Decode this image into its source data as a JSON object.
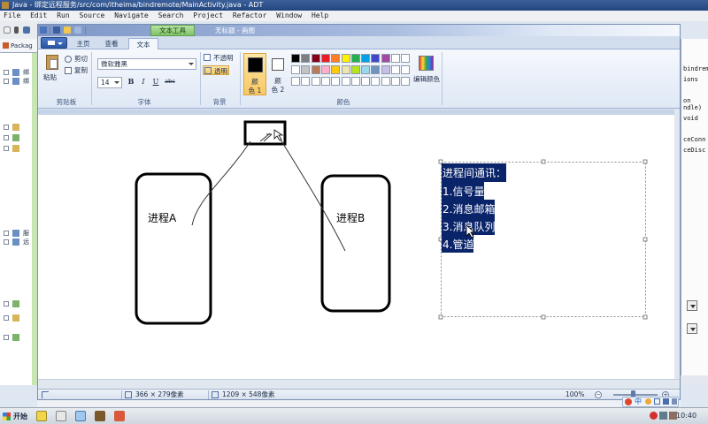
{
  "eclipse": {
    "title": "Java - 绑定远程服务/src/com/itheima/bindremote/MainActivity.java - ADT",
    "menu": [
      "File",
      "Edit",
      "Run",
      "Source",
      "Navigate",
      "Search",
      "Project",
      "Refactor",
      "Window",
      "Help"
    ],
    "package_tab": "Packag",
    "tree_items": [
      "绑",
      "绑",
      "服",
      "远"
    ],
    "code_fragments": [
      "bindremot",
      "ions",
      "on",
      "ndle)",
      "void",
      "ceConn",
      "ceDisc"
    ]
  },
  "paint": {
    "context_tab": "文本工具",
    "window_title": "无标题 - 画图",
    "tabs": [
      "主页",
      "查看",
      "文本"
    ],
    "clipboard": {
      "paste": "粘贴",
      "cut": "剪切",
      "copy": "复制",
      "label": "剪贴板"
    },
    "font": {
      "family": "微软雅黑",
      "size": "14",
      "bold": "B",
      "italic": "I",
      "underline": "U",
      "strike": "abc",
      "label": "字体"
    },
    "background": {
      "opaque": "不透明",
      "transparent": "透明",
      "label": "背景"
    },
    "colors": {
      "color1_line1": "颜",
      "color1_line2": "色 1",
      "color2_line1": "颜",
      "color2_line2": "色 2",
      "edit": "编辑颜色",
      "label": "颜色",
      "color1": "#000000",
      "color2": "#ffffff",
      "palette": [
        "#000000",
        "#7f7f7f",
        "#880015",
        "#ed1c24",
        "#ff7f27",
        "#fff200",
        "#22b14c",
        "#00a2e8",
        "#3f48cc",
        "#a349a4",
        "#ffffff",
        "#ffffff",
        "#ffffff",
        "#c3c3c3",
        "#b97a57",
        "#ffaec9",
        "#ffc90e",
        "#efe4b0",
        "#b5e61d",
        "#99d9ea",
        "#7092be",
        "#c8bfe7",
        "#ffffff",
        "#ffffff",
        "#ffffff",
        "#ffffff",
        "#ffffff",
        "#ffffff",
        "#ffffff",
        "#ffffff",
        "#ffffff",
        "#ffffff",
        "#ffffff",
        "#ffffff",
        "#ffffff",
        "#ffffff"
      ]
    },
    "canvas": {
      "process_a": "进程A",
      "process_b": "进程B",
      "ipc_title": "进程间通讯：",
      "ipc_items": [
        "1.信号量",
        "2.消息邮箱",
        "3.消息队列",
        "4.管道"
      ],
      "selection_color": "#0a246a"
    },
    "status": {
      "cursor": "366 × 279像素",
      "canvas_size": "1209 × 548像素",
      "zoom": "100%"
    }
  },
  "taskbar": {
    "start": "开始",
    "clock": "10:40",
    "ime": "中"
  }
}
